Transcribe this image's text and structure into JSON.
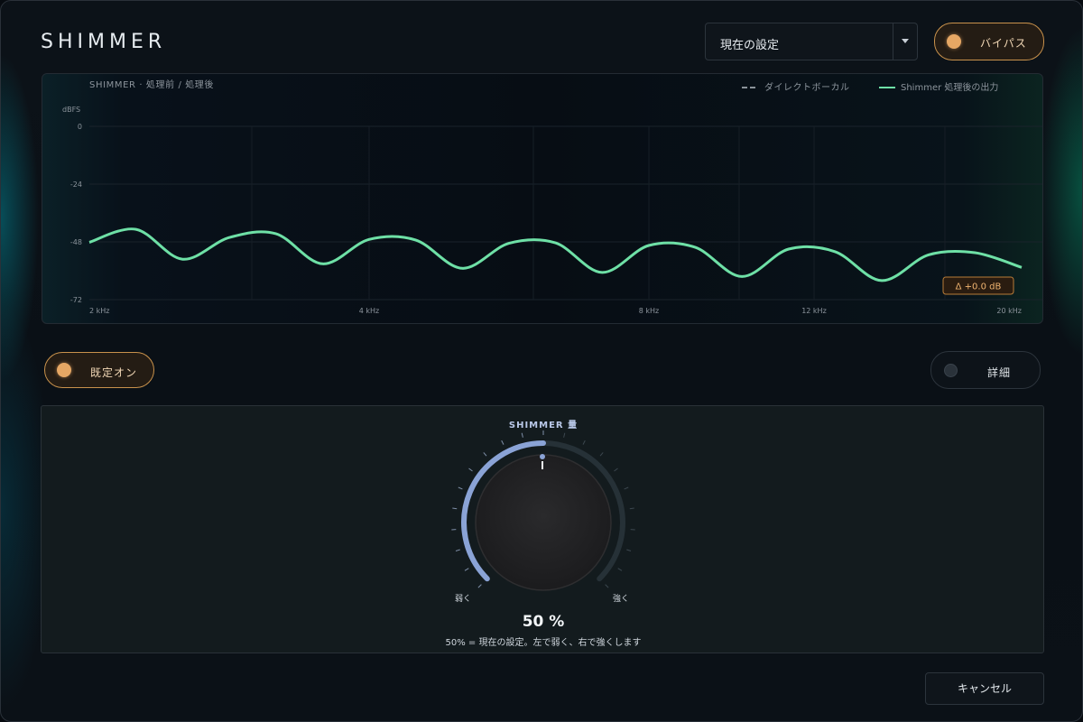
{
  "app": {
    "title": "SHIMMER"
  },
  "header": {
    "preset": {
      "selected": "現在の設定"
    },
    "bypass": {
      "label": "バイパス",
      "state": "on"
    }
  },
  "chart": {
    "caption": "SHIMMER · 処理前 / 処理後",
    "legend": {
      "dry": "ダイレクトボーカル",
      "wet": "Shimmer 処理後の出力"
    },
    "delta_badge": "Δ  +0.0 dB"
  },
  "chart_data": {
    "type": "line",
    "title": "SHIMMER · 処理前 / 処理後",
    "ylabel": "dBFS",
    "xlabel": "",
    "y_ticks": [
      "0",
      "-24",
      "-48",
      "-72"
    ],
    "x_ticks": [
      "2 kHz",
      "4 kHz",
      "8 kHz",
      "12 kHz",
      "20 kHz"
    ],
    "ylim": [
      -72,
      0
    ],
    "grid": true,
    "legend_position": "top-right",
    "series": [
      {
        "name": "Shimmer 処理後の出力",
        "color": "#6ee0a6",
        "style": "solid",
        "x_frac": [
          0,
          0.05,
          0.1,
          0.15,
          0.2,
          0.25,
          0.3,
          0.35,
          0.4,
          0.45,
          0.5,
          0.55,
          0.6,
          0.65,
          0.7,
          0.75,
          0.8,
          0.85,
          0.9,
          0.95,
          1.0
        ],
        "values": [
          -48.2,
          -42.8,
          -55.2,
          -46.2,
          -44.6,
          -57.1,
          -47.0,
          -47.2,
          -59.0,
          -48.6,
          -48.4,
          -60.7,
          -49.5,
          -50.3,
          -62.4,
          -51.0,
          -52.1,
          -64.1,
          -53.4,
          -52.5,
          -58.6
        ]
      },
      {
        "name": "ダイレクトボーカル",
        "color": "#8a9299",
        "style": "dashed",
        "values": []
      }
    ]
  },
  "controls": {
    "default_on": {
      "label": "既定オン",
      "state": "on"
    },
    "detail": {
      "label": "詳細",
      "state": "off"
    }
  },
  "knob": {
    "title": "SHIMMER 量",
    "value": 50,
    "value_text": "50 %",
    "min_label": "弱く",
    "max_label": "強く",
    "help": "50% = 現在の設定。左で弱く、右で強くします",
    "accent": "#8aa3d6"
  },
  "footer": {
    "cancel_label": "キャンセル"
  },
  "colors": {
    "accent_orange": "#e6a764",
    "curve": "#6ee0a6",
    "knob_arc": "#8aa3d6"
  }
}
